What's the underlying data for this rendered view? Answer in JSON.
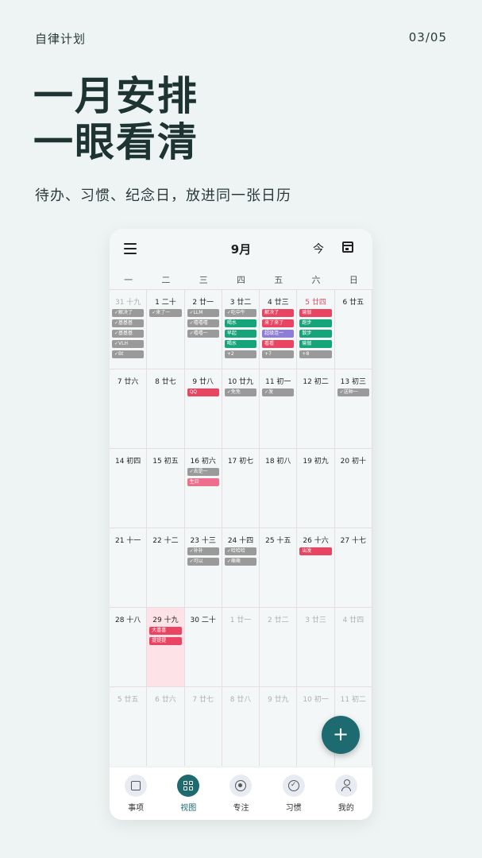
{
  "header": {
    "app_name": "自律计划",
    "page_indicator": "03/05"
  },
  "headline": {
    "line1": "一月安排",
    "line2": "一眼看清"
  },
  "subline": "待办、习惯、纪念日，放进同一张日历",
  "calendar": {
    "month_title": "9月",
    "today_label": "今",
    "icons": {
      "menu": "menu-icon",
      "calendar": "calendar-icon"
    },
    "weekdays": [
      "一",
      "二",
      "三",
      "四",
      "五",
      "六",
      "日"
    ],
    "weeks": [
      [
        {
          "day": "31 十九",
          "dim": true,
          "events": [
            {
              "t": "✓解决了",
              "c": "gray"
            },
            {
              "t": "✓基基基",
              "c": "gray"
            },
            {
              "t": "✓基基基",
              "c": "gray"
            },
            {
              "t": "✓VLH",
              "c": "gray"
            },
            {
              "t": "✓Bt",
              "c": "gray"
            }
          ]
        },
        {
          "day": "1 二十",
          "events": [
            {
              "t": "✓来了一",
              "c": "gray"
            }
          ]
        },
        {
          "day": "2 廿一",
          "events": [
            {
              "t": "✓LLM",
              "c": "gray"
            },
            {
              "t": "✓嘻嘻嘻",
              "c": "gray"
            },
            {
              "t": "✓嘻嘻一",
              "c": "gray"
            }
          ]
        },
        {
          "day": "3 廿二",
          "events": [
            {
              "t": "✓吃中午",
              "c": "gray"
            },
            {
              "t": "喝水",
              "c": "green"
            },
            {
              "t": "早起",
              "c": "green"
            },
            {
              "t": "喝水",
              "c": "green"
            },
            {
              "t": "+2",
              "c": "gray"
            }
          ]
        },
        {
          "day": "4 廿三",
          "events": [
            {
              "t": "解决了",
              "c": "red"
            },
            {
              "t": "来了来了",
              "c": "red"
            },
            {
              "t": "超级连一",
              "c": "purple"
            },
            {
              "t": "看看",
              "c": "red"
            },
            {
              "t": "+7",
              "c": "gray"
            }
          ]
        },
        {
          "day": "5 廿四",
          "red": true,
          "events": [
            {
              "t": "瑜伽",
              "c": "red"
            },
            {
              "t": "跑步",
              "c": "green"
            },
            {
              "t": "散步",
              "c": "green"
            },
            {
              "t": "瑜伽",
              "c": "green"
            },
            {
              "t": "+8",
              "c": "gray"
            }
          ]
        },
        {
          "day": "6 廿五",
          "events": []
        }
      ],
      [
        {
          "day": "7 廿六",
          "events": []
        },
        {
          "day": "8 廿七",
          "events": []
        },
        {
          "day": "9 廿八",
          "events": [
            {
              "t": "QQ",
              "c": "red"
            }
          ]
        },
        {
          "day": "10 廿九",
          "events": [
            {
              "t": "✓免免",
              "c": "gray"
            }
          ]
        },
        {
          "day": "11 初一",
          "events": [
            {
              "t": "✓发",
              "c": "gray"
            }
          ]
        },
        {
          "day": "12 初二",
          "events": []
        },
        {
          "day": "13 初三",
          "events": [
            {
              "t": "✓送种一",
              "c": "gray"
            }
          ]
        }
      ],
      [
        {
          "day": "14 初四",
          "events": []
        },
        {
          "day": "15 初五",
          "events": []
        },
        {
          "day": "16 初六",
          "events": [
            {
              "t": "✓去是一",
              "c": "gray"
            },
            {
              "t": "生日",
              "c": "pink"
            }
          ]
        },
        {
          "day": "17 初七",
          "events": []
        },
        {
          "day": "18 初八",
          "events": []
        },
        {
          "day": "19 初九",
          "events": []
        },
        {
          "day": "20 初十",
          "events": []
        }
      ],
      [
        {
          "day": "21 十一",
          "events": []
        },
        {
          "day": "22 十二",
          "events": []
        },
        {
          "day": "23 十三",
          "events": [
            {
              "t": "✓补补",
              "c": "gray"
            },
            {
              "t": "✓可以",
              "c": "gray"
            }
          ]
        },
        {
          "day": "24 十四",
          "events": [
            {
              "t": "✓哈哈哈",
              "c": "gray"
            },
            {
              "t": "✓嘶嘶",
              "c": "gray"
            }
          ]
        },
        {
          "day": "25 十五",
          "events": []
        },
        {
          "day": "26 十六",
          "events": [
            {
              "t": "出发",
              "c": "red"
            }
          ]
        },
        {
          "day": "27 十七",
          "events": []
        }
      ],
      [
        {
          "day": "28 十八",
          "events": []
        },
        {
          "day": "29 十九",
          "today": true,
          "events": [
            {
              "t": "大喜喜",
              "c": "red"
            },
            {
              "t": "提提提",
              "c": "red"
            }
          ]
        },
        {
          "day": "30 二十",
          "events": []
        },
        {
          "day": "1 廿一",
          "dim": true,
          "events": []
        },
        {
          "day": "2 廿二",
          "dim": true,
          "events": []
        },
        {
          "day": "3 廿三",
          "dim": true,
          "events": []
        },
        {
          "day": "4 廿四",
          "dim": true,
          "events": []
        }
      ],
      [
        {
          "day": "5 廿五",
          "dim": true,
          "events": []
        },
        {
          "day": "6 廿六",
          "dim": true,
          "events": []
        },
        {
          "day": "7 廿七",
          "dim": true,
          "events": []
        },
        {
          "day": "8 廿八",
          "dim": true,
          "events": []
        },
        {
          "day": "9 廿九",
          "dim": true,
          "events": []
        },
        {
          "day": "10 初一",
          "dim": true,
          "events": []
        },
        {
          "day": "11 初二",
          "dim": true,
          "events": []
        }
      ]
    ],
    "fab_label": "+"
  },
  "tabs": [
    {
      "label": "事项",
      "icon": "list-icon",
      "active": false
    },
    {
      "label": "视图",
      "icon": "grid-icon",
      "active": true
    },
    {
      "label": "专注",
      "icon": "target-icon",
      "active": false
    },
    {
      "label": "习惯",
      "icon": "check-circle-icon",
      "active": false
    },
    {
      "label": "我的",
      "icon": "user-icon",
      "active": false
    }
  ]
}
